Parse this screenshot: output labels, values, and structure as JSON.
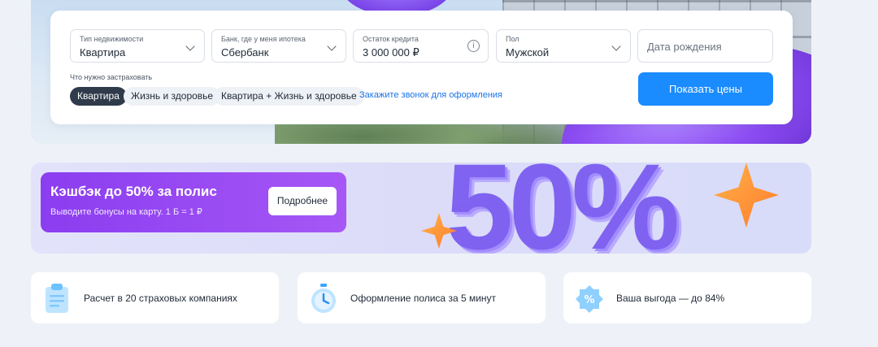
{
  "form": {
    "property_type": {
      "label": "Тип недвижимости",
      "value": "Квартира"
    },
    "bank": {
      "label": "Банк, где у меня ипотека",
      "value": "Сбербанк"
    },
    "loan_balance": {
      "label": "Остаток кредита",
      "value": "3 000 000 ₽"
    },
    "gender": {
      "label": "Пол",
      "value": "Мужской"
    },
    "birth_date": {
      "placeholder": "Дата рождения"
    },
    "insure_label": "Что нужно застраховать",
    "options": [
      "Квартира",
      "Жизнь и здоровье",
      "Квартира + Жизнь и здоровье"
    ],
    "active_option": "Квартира",
    "call_link": "Закажите звонок для оформления",
    "submit_label": "Показать цены"
  },
  "cashback": {
    "title": "Кэшбэк до 50% за полис",
    "subtitle": "Выводите бонусы на карту. 1 Б = 1 ₽",
    "button": "Подробнее",
    "big_number": "50%"
  },
  "features": [
    {
      "text": "Расчет в 20 страховых компаниях",
      "icon": "clipboard-icon"
    },
    {
      "text": "Оформление полиса за 5 минут",
      "icon": "stopwatch-icon"
    },
    {
      "text": "Ваша выгода — до 84%",
      "icon": "percent-badge-icon"
    }
  ],
  "colors": {
    "accent": "#1a8cff",
    "link": "#1a73e8",
    "active_pill": "#2f3a4a",
    "cashback_purple": "#8b3df0"
  }
}
